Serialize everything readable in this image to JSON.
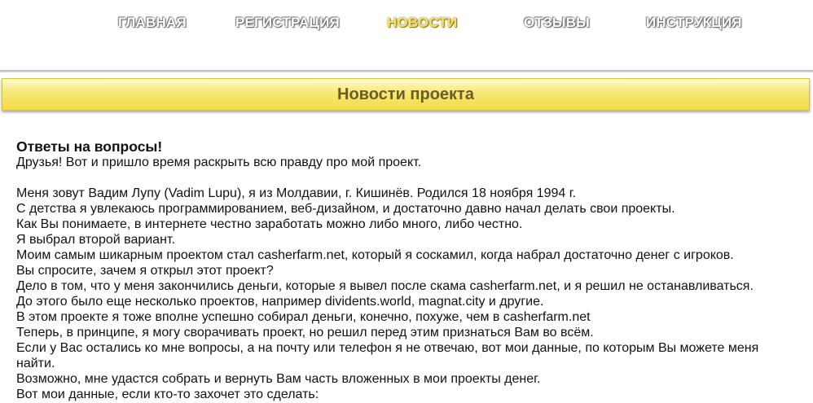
{
  "nav": {
    "items": [
      {
        "label": "ГЛАВНАЯ",
        "active": false
      },
      {
        "label": "РЕГИСТРАЦИЯ",
        "active": false
      },
      {
        "label": "НОВОСТИ",
        "active": true
      },
      {
        "label": "ОТЗЫВЫ",
        "active": false
      },
      {
        "label": "ИНСТРУКЦИЯ",
        "active": false
      }
    ],
    "text_color": "#ffffff",
    "active_color": "#f6e06a"
  },
  "section": {
    "title": "Новости проекта",
    "bar_color": "#f2da45",
    "title_color": "#6b5d28"
  },
  "article": {
    "headline": "Ответы на вопросы!",
    "intro": "Друзья! Вот и пришло время раскрыть всю правду про мой проект.",
    "lines": [
      "Меня зовут Вадим Лупу (Vadim Lupu), я из Молдавии, г. Кишинёв. Родился 18 ноября 1994 г.",
      "С детства я увлекаюсь программированием, веб-дизайном, и достаточно давно начал делать свои проекты.",
      "Как Вы понимаете, в интернете честно заработать можно либо много, либо честно.",
      "Я выбрал второй вариант.",
      "Моим самым шикарным проектом стал casherfarm.net, который я соскамил, когда набрал достаточно денег с игроков.",
      "Вы спросите, зачем я открыл этот проект?",
      "Дело в том, что у меня закончились деньги, которые я вывел после скама casherfarm.net, и я решил не останавливаться.",
      "До этого было еще несколько проектов, например dividents.world, magnat.city и другие.",
      "В этом проекте я тоже вполне успешно собирал деньги, конечно, похуже, чем в casherfarm.net",
      "Теперь, в принципе, я могу сворачивать проект, но решил перед этим признаться Вам во всём.",
      "Если у Вас остались ко мне вопросы, а на почту или телефон я не отвечаю, вот мои данные, по которым Вы можете меня найти.",
      "Возможно, мне удастся собрать и вернуть Вам часть вложенных в мои проекты денег.",
      "Вот мои данные, если кто-то захочет это сделать:"
    ]
  }
}
